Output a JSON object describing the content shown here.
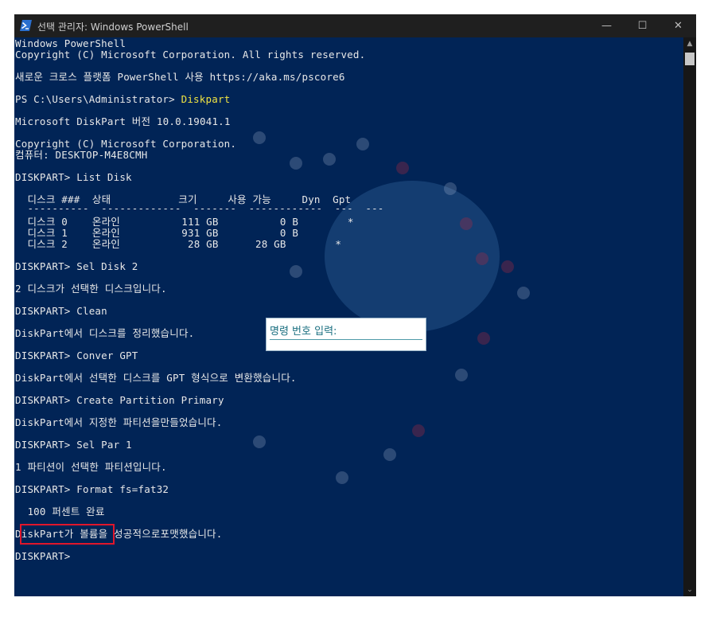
{
  "window": {
    "title": "선택 관리자: Windows PowerShell",
    "controls": {
      "minimize": "—",
      "maximize": "☐",
      "close": "✕"
    }
  },
  "console": {
    "lines": [
      "Windows PowerShell",
      "Copyright (C) Microsoft Corporation. All rights reserved.",
      "새로운 크로스 플랫폼 PowerShell 사용 https://aka.ms/pscore6",
      "PS C:\\Users\\Administrator>",
      "Diskpart",
      "Microsoft DiskPart 버전 10.0.19041.1",
      "Copyright (C) Microsoft Corporation.",
      "컴퓨터: DESKTOP-M4E8CMH",
      "DISKPART> List Disk",
      "  디스크 ###  상태           크기     사용 가능     Dyn  Gpt",
      "  ----------  -------------  -------  ------------  ---  ---",
      "  디스크 0    온라인          111 GB          0 B        *",
      "  디스크 1    온라인          931 GB          0 B",
      "  디스크 2    온라인           28 GB      28 GB        *",
      "DISKPART> Sel Disk 2",
      "2 디스크가 선택한 디스크입니다.",
      "DISKPART> Clean",
      "DiskPart에서 디스크를 정리했습니다.",
      "DISKPART> Conver GPT",
      "DiskPart에서 선택한 디스크를 GPT 형식으로 변환했습니다.",
      "DISKPART> Create Partition Primary",
      "DiskPart에서 지정한 파티션을만들었습니다.",
      "DISKPART> Sel Par 1",
      "1 파티션이 선택한 파티션입니다.",
      "DISKPART> Format fs=fat32",
      "  100 퍼센트 완료",
      "DiskPart가 볼륨을 성공적으로포맷했습니다.",
      "DISKPART>"
    ]
  },
  "overlay": {
    "label": "명령 번호 입력:"
  },
  "scrollbar": {
    "up": "▲",
    "down": "⌄"
  },
  "colors": {
    "console_bg": "#012456",
    "text": "#e8e8e8",
    "command_highlight": "#f0e442",
    "annotation_border": "#e0162b"
  }
}
